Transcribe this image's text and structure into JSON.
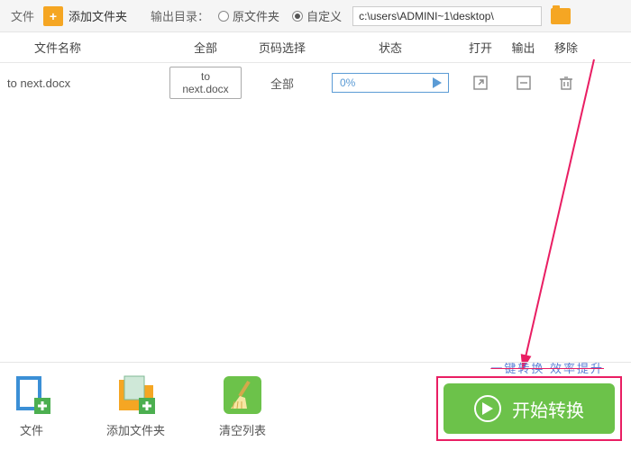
{
  "topbar": {
    "file_label": "文件",
    "add_folder_label": "添加文件夹",
    "output_dir_label": "输出目录：",
    "radio_original": "原文件夹",
    "radio_custom": "自定义",
    "path_value": "c:\\users\\ADMINI~1\\desktop\\"
  },
  "columns": {
    "name": "文件名称",
    "all": "全部",
    "page": "页码选择",
    "status": "状态",
    "open": "打开",
    "output": "输出",
    "remove": "移除"
  },
  "row": {
    "filename": "to next.docx",
    "badge": "to next.docx",
    "page_sel": "全部",
    "progress_pct": "0%"
  },
  "bottom": {
    "file": "文件",
    "add_folder": "添加文件夹",
    "clear_list": "清空列表"
  },
  "promo_text": "一键转换 效率提升",
  "start_label": "开始转换"
}
